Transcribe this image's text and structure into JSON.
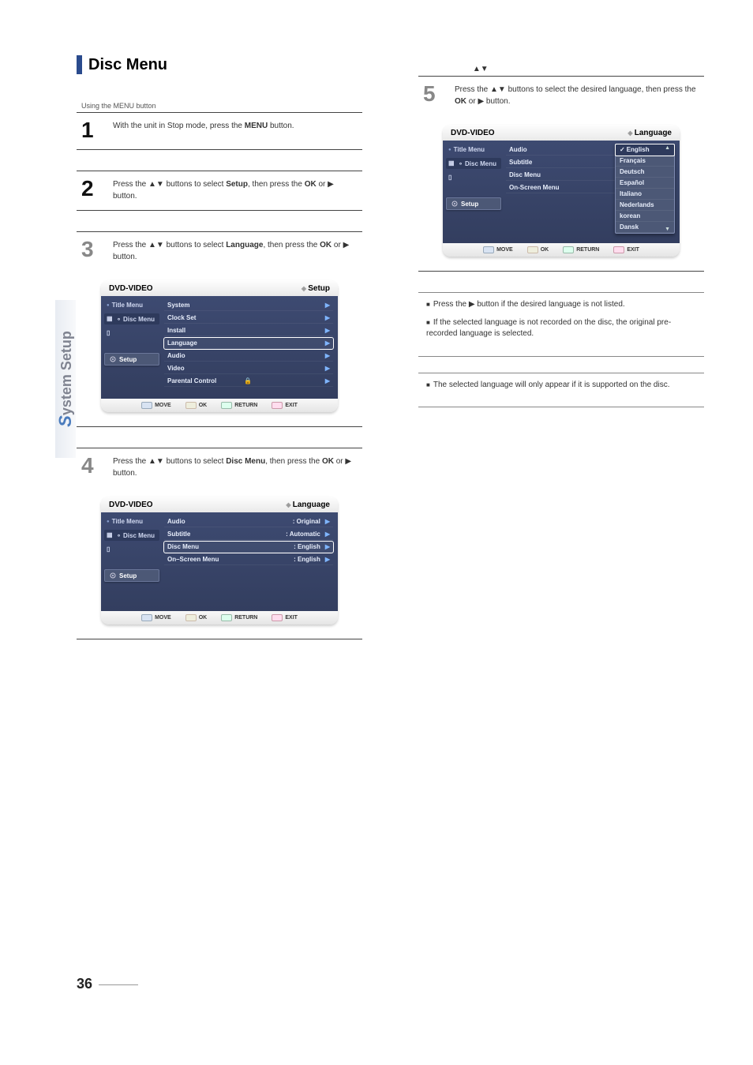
{
  "page_number": "36",
  "side_tab": {
    "s": "S",
    "rest": "ystem Setup"
  },
  "section": {
    "title": "Disc Menu"
  },
  "steps": {
    "s1": {
      "label": "Using the MENU button",
      "num": "1",
      "text_a": "With the unit in Stop mode, press the ",
      "text_bold": "MENU",
      "text_b": " button."
    },
    "s2": {
      "num": "2",
      "text_a": "Press the ▲▼ buttons to select ",
      "text_bold": "Setup",
      "text_b": ", then press the ",
      "text_bold2": "OK",
      "text_c": " or ▶ button."
    },
    "s3": {
      "num": "3",
      "text_a": "Press the ▲▼ buttons to select ",
      "text_bold": "Language",
      "text_b": ", then press the ",
      "text_bold2": "OK",
      "text_c": " or ▶ button."
    },
    "s4": {
      "num": "4",
      "text_a": "Press the ▲▼ buttons to select ",
      "text_bold": "Disc Menu",
      "text_b": ", then press the ",
      "text_bold2": "OK",
      "text_c": " or ▶ button."
    },
    "s5_pre": "Press the ▲▼ buttons to select ",
    "s5": {
      "num": "5",
      "text_a": "Press the ▲▼ buttons to select the desired language, then press the ",
      "text_bold": "OK",
      "text_b": " or ▶ button."
    }
  },
  "bullets": {
    "b1": {
      "pre": "Press the ▶ button if the desired language is not listed.",
      "main": ""
    },
    "b2": {
      "pre": "If the selected language is not recorded on the disc, the original pre-recorded language is selected."
    },
    "b3": {
      "pre": "The selected language will only appear if it is supported on the disc."
    }
  },
  "osd_common": {
    "dvd_video": "DVD-VIDEO",
    "title_menu": "Title Menu",
    "disc_menu": "Disc Menu",
    "setup": "Setup",
    "foot_move": "MOVE",
    "foot_ok": "OK",
    "foot_return": "RETURN",
    "foot_exit": "EXIT"
  },
  "osd_setup": {
    "right_title": "Setup",
    "items": {
      "system": "System",
      "clock_set": "Clock Set",
      "install": "Install",
      "language": "Language",
      "audio": "Audio",
      "video": "Video",
      "parental": "Parental Control"
    }
  },
  "osd_lang": {
    "right_title": "Language",
    "rows": {
      "audio": "Audio",
      "audio_val": ": Original",
      "subtitle": "Subtitle",
      "subtitle_val": ": Automatic",
      "discmenu": "Disc Menu",
      "discmenu_val": ": English",
      "onscreen": "On–Screen Menu",
      "onscreen_val": ": English"
    }
  },
  "osd_drop": {
    "right_title": "Language",
    "rows": {
      "audio": "Audio",
      "subtitle": "Subtitle",
      "discmenu": "Disc Menu",
      "onscreen": "On-Screen Menu"
    },
    "options": {
      "english": "English",
      "francais": "Français",
      "deutsch": "Deutsch",
      "espanol": "Español",
      "italiano": "Italiano",
      "nederlands": "Nederlands",
      "korean": "korean",
      "dansk": "Dansk"
    }
  }
}
